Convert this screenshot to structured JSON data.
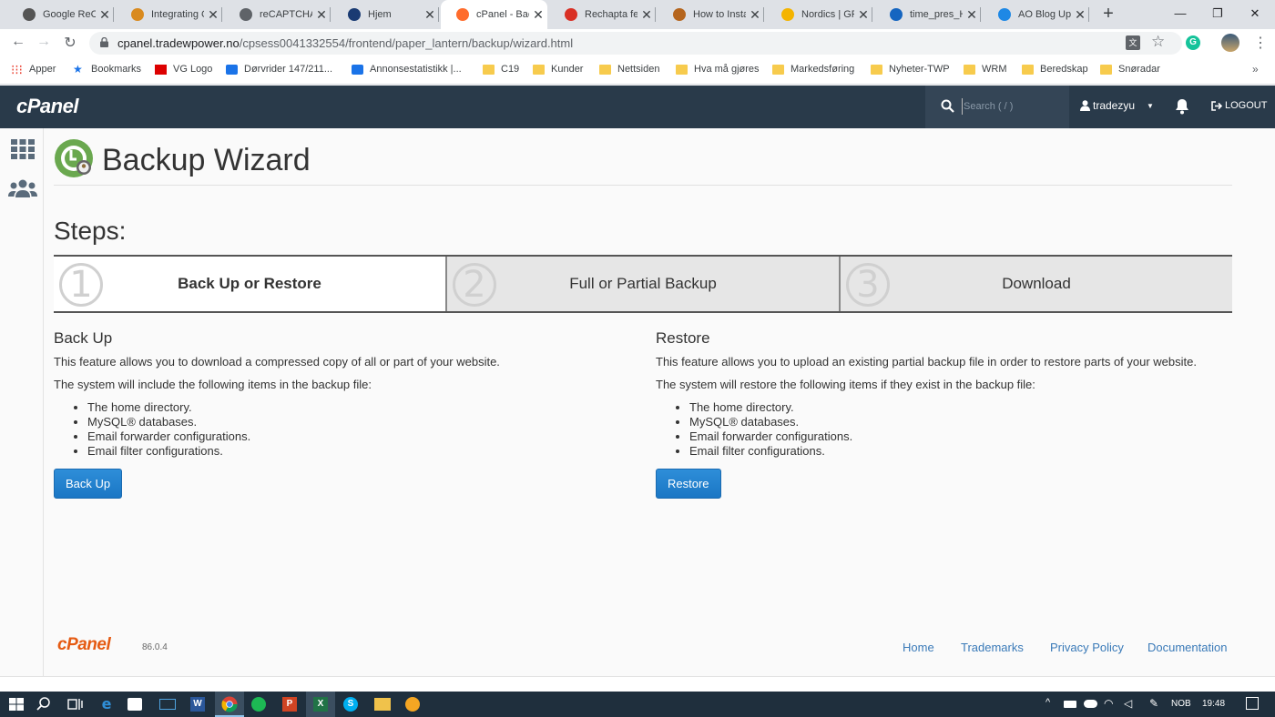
{
  "browser": {
    "tabs": [
      {
        "title": "Google ReCa",
        "icon": "wordpress-icon",
        "color": "#555555"
      },
      {
        "title": "Integrating C",
        "icon": "gear-icon",
        "color": "#d98a1e"
      },
      {
        "title": "reCAPTCHA",
        "icon": "globe-icon",
        "color": "#5f6368"
      },
      {
        "title": "Hjem",
        "icon": "site-icon",
        "color": "#1a3b73"
      },
      {
        "title": "cPanel - Bac",
        "icon": "cpanel-icon",
        "color": "#ff6c2c",
        "active": true
      },
      {
        "title": "Rechapta fe",
        "icon": "gmail-icon",
        "color": "#d93025"
      },
      {
        "title": "How to Insta",
        "icon": "site-icon",
        "color": "#b5651d"
      },
      {
        "title": "Nordics | GF",
        "icon": "site-icon",
        "color": "#f4b400"
      },
      {
        "title": "time_pres_H",
        "icon": "site-icon",
        "color": "#1565c0"
      },
      {
        "title": "AO Blog Upc",
        "icon": "site-icon",
        "color": "#1e88e5"
      }
    ],
    "url_domain": "cpanel.tradewpower.no",
    "url_path": "/cpsess0041332554/frontend/paper_lantern/backup/wizard.html",
    "bookmarks": [
      {
        "label": "Apper",
        "type": "apps"
      },
      {
        "label": "Bookmarks",
        "type": "star"
      },
      {
        "label": "VG Logo",
        "type": "vg"
      },
      {
        "label": "Dørvrider 147/211...",
        "type": "site"
      },
      {
        "label": "Annonsestatistikk |...",
        "type": "site"
      },
      {
        "label": "C19",
        "type": "folder"
      },
      {
        "label": "Kunder",
        "type": "folder"
      },
      {
        "label": "Nettsiden",
        "type": "folder"
      },
      {
        "label": "Hva må gjøres",
        "type": "folder"
      },
      {
        "label": "Markedsføring",
        "type": "folder"
      },
      {
        "label": "Nyheter-TWP",
        "type": "folder"
      },
      {
        "label": "WRM",
        "type": "folder"
      },
      {
        "label": "Beredskap",
        "type": "folder"
      },
      {
        "label": "Snøradar",
        "type": "folder"
      }
    ]
  },
  "cpanel": {
    "logo": "cPanel",
    "search_placeholder": "Search ( / )",
    "username": "tradezyu",
    "logout_label": "LOGOUT"
  },
  "page": {
    "title": "Backup Wizard",
    "steps_heading": "Steps:",
    "steps": [
      {
        "number": "1",
        "label": "Back Up or Restore"
      },
      {
        "number": "2",
        "label": "Full or Partial Backup"
      },
      {
        "number": "3",
        "label": "Download"
      }
    ]
  },
  "backup": {
    "heading": "Back Up",
    "description": "This feature allows you to download a compressed copy of all or part of your website.",
    "intro": "The system will include the following items in the backup file:",
    "items": [
      "The home directory.",
      "MySQL® databases.",
      "Email forwarder configurations.",
      "Email filter configurations."
    ],
    "button": "Back Up"
  },
  "restore": {
    "heading": "Restore",
    "description": "This feature allows you to upload an existing partial backup file in order to restore parts of your website.",
    "intro": "The system will restore the following items if they exist in the backup file:",
    "items": [
      "The home directory.",
      "MySQL® databases.",
      "Email forwarder configurations.",
      "Email filter configurations."
    ],
    "button": "Restore"
  },
  "footer": {
    "logo": "cPanel",
    "version": "86.0.4",
    "links": [
      "Home",
      "Trademarks",
      "Privacy Policy",
      "Documentation"
    ]
  },
  "taskbar": {
    "language": "NOB",
    "time": "19:48"
  }
}
